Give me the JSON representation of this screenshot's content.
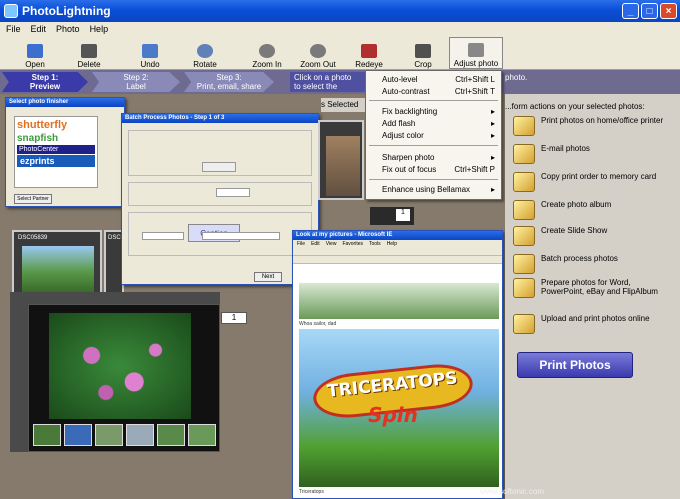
{
  "app": {
    "title": "PhotoLightning"
  },
  "menu": [
    "File",
    "Edit",
    "Photo",
    "Help"
  ],
  "toolbar": [
    "Open",
    "Delete",
    "Undo",
    "Rotate",
    "Zoom In",
    "Zoom Out",
    "Redeye",
    "Crop",
    "Adjust photo"
  ],
  "steps": [
    {
      "n": "Step 1:",
      "l": "Preview"
    },
    {
      "n": "Step 2:",
      "l": "Label"
    },
    {
      "n": "Step 3:",
      "l": "Print, email, share"
    }
  ],
  "hint": {
    "line1": "Click on a photo",
    "line2": "to select the",
    "tail": "photo."
  },
  "adjust_menu": [
    {
      "label": "Auto-level",
      "shortcut": "Ctrl+Shift L"
    },
    {
      "label": "Auto-contrast",
      "shortcut": "Ctrl+Shift T"
    },
    {
      "label": "Fix backlighting",
      "shortcut": "▸"
    },
    {
      "label": "Add flash",
      "shortcut": "▸"
    },
    {
      "label": "Adjust color",
      "shortcut": "▸"
    },
    {
      "label": "Sharpen photo",
      "shortcut": "▸"
    },
    {
      "label": "Fix out of focus",
      "shortcut": "Ctrl+Shift P"
    },
    {
      "label": "Enhance using Bellamax",
      "shortcut": "▸"
    }
  ],
  "right_panel": {
    "heading": "...form actions on your selected photos:",
    "items": [
      "Print photos on home/office printer",
      "E-mail photos",
      "Copy print order to memory card",
      "Create photo album",
      "Create Slide Show",
      "Batch process photos",
      "Prepare photos for Word, PowerPoint, eBay and FlipAlbum",
      "Upload and print photos online"
    ],
    "print_button": "Print Photos"
  },
  "partner": {
    "title": "Select photo finisher",
    "logos": [
      "shutterfly",
      "snapfish",
      "PhotoCenter",
      "ezprints"
    ],
    "button": "Select Partner"
  },
  "batch": {
    "title": "Batch Process Photos - Step 1 of 3",
    "caption": "Caption",
    "btn": "Next",
    "selected_tail": "s Selected"
  },
  "thumbs": {
    "label1": "DSC05839",
    "label2": "DSCO9"
  },
  "ie": {
    "title": "Look at my pictures - Microsoft IE",
    "menu": [
      "File",
      "Edit",
      "View",
      "Favorites",
      "Tools",
      "Help"
    ],
    "title_text": "TRICERATOPS",
    "sub_text": "Spin",
    "caption1": "Whoa sailor, dad",
    "caption2": "Triceratops"
  },
  "watermark": "www.softonic.com",
  "colors": {
    "title_blue": "#0b45c2",
    "step_active": "#3a3aa8",
    "print": "#3a3ab0"
  }
}
